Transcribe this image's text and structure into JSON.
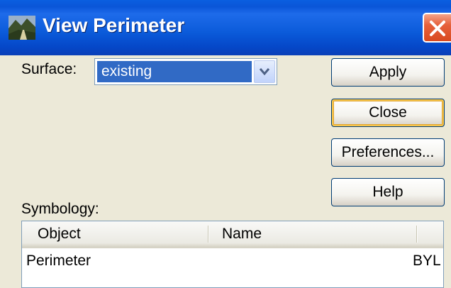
{
  "window": {
    "title": "View Perimeter"
  },
  "surface": {
    "label": "Surface:",
    "selected": "existing"
  },
  "buttons": {
    "apply": "Apply",
    "close": "Close",
    "preferences": "Preferences...",
    "help": "Help"
  },
  "symbology": {
    "label": "Symbology:",
    "columns": [
      "Object",
      "Name",
      ""
    ],
    "rows": [
      {
        "object": "Perimeter",
        "name": "BYL"
      }
    ]
  },
  "colors": {
    "titlebar": "#0a55d8",
    "selection": "#316ac5",
    "dialog_bg": "#ece9d8",
    "close_button": "#e6603b"
  }
}
